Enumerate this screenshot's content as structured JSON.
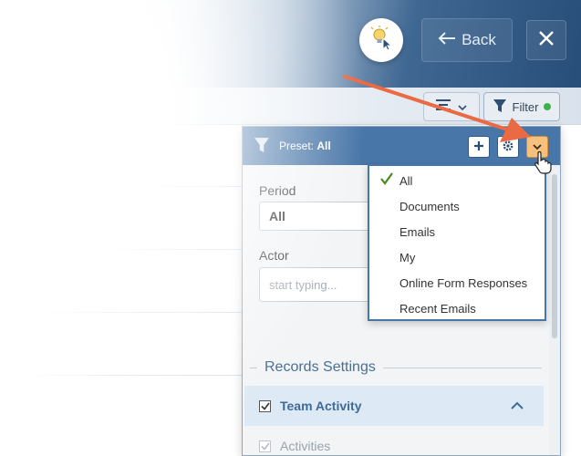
{
  "header": {
    "back_label": "Back",
    "icons": [
      "lightbulb-cursor-icon",
      "arrow-left-icon",
      "close-icon"
    ]
  },
  "toolbar": {
    "filter_label": "Filter",
    "filter_status_color": "#3bb24a",
    "icons": [
      "list-view-icon",
      "chevron-down-icon",
      "funnel-icon"
    ]
  },
  "panel": {
    "preset_prefix": "Preset:",
    "preset_value": "All",
    "header_color": "#4876a8",
    "fields": {
      "period_label": "Period",
      "period_value": "All",
      "actor_label": "Actor",
      "actor_placeholder": "start typing..."
    },
    "records_settings_title": "Records Settings",
    "team_activity_label": "Team Activity",
    "activities_label": "Activities"
  },
  "dropdown": {
    "items": [
      {
        "label": "All",
        "selected": true
      },
      {
        "label": "Documents",
        "selected": false
      },
      {
        "label": "Emails",
        "selected": false
      },
      {
        "label": "My",
        "selected": false
      },
      {
        "label": "Online Form Responses",
        "selected": false
      },
      {
        "label": "Recent Emails",
        "selected": false
      }
    ]
  },
  "annotation": {
    "arrow_color": "#ea6a43"
  }
}
